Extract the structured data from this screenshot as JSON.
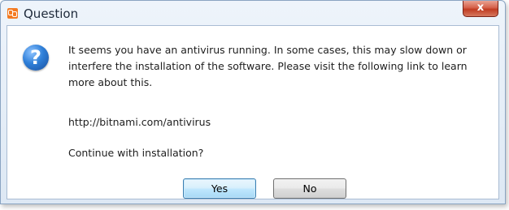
{
  "window": {
    "title": "Question",
    "close_glyph": "x"
  },
  "icons": {
    "app": "xampp-icon",
    "message": "question-icon",
    "question_glyph": "?"
  },
  "message": {
    "body": "It seems you have an antivirus running. In some cases, this may slow down or interfere the installation of the software. Please visit the following link to learn more about this.",
    "link": "http://bitnami.com/antivirus",
    "prompt": "Continue with installation?"
  },
  "buttons": {
    "yes_label": "Yes",
    "no_label": "No"
  },
  "colors": {
    "app_icon": "#f47a20",
    "close_button": "#c03c22",
    "default_button_border": "#3c7fb1"
  }
}
